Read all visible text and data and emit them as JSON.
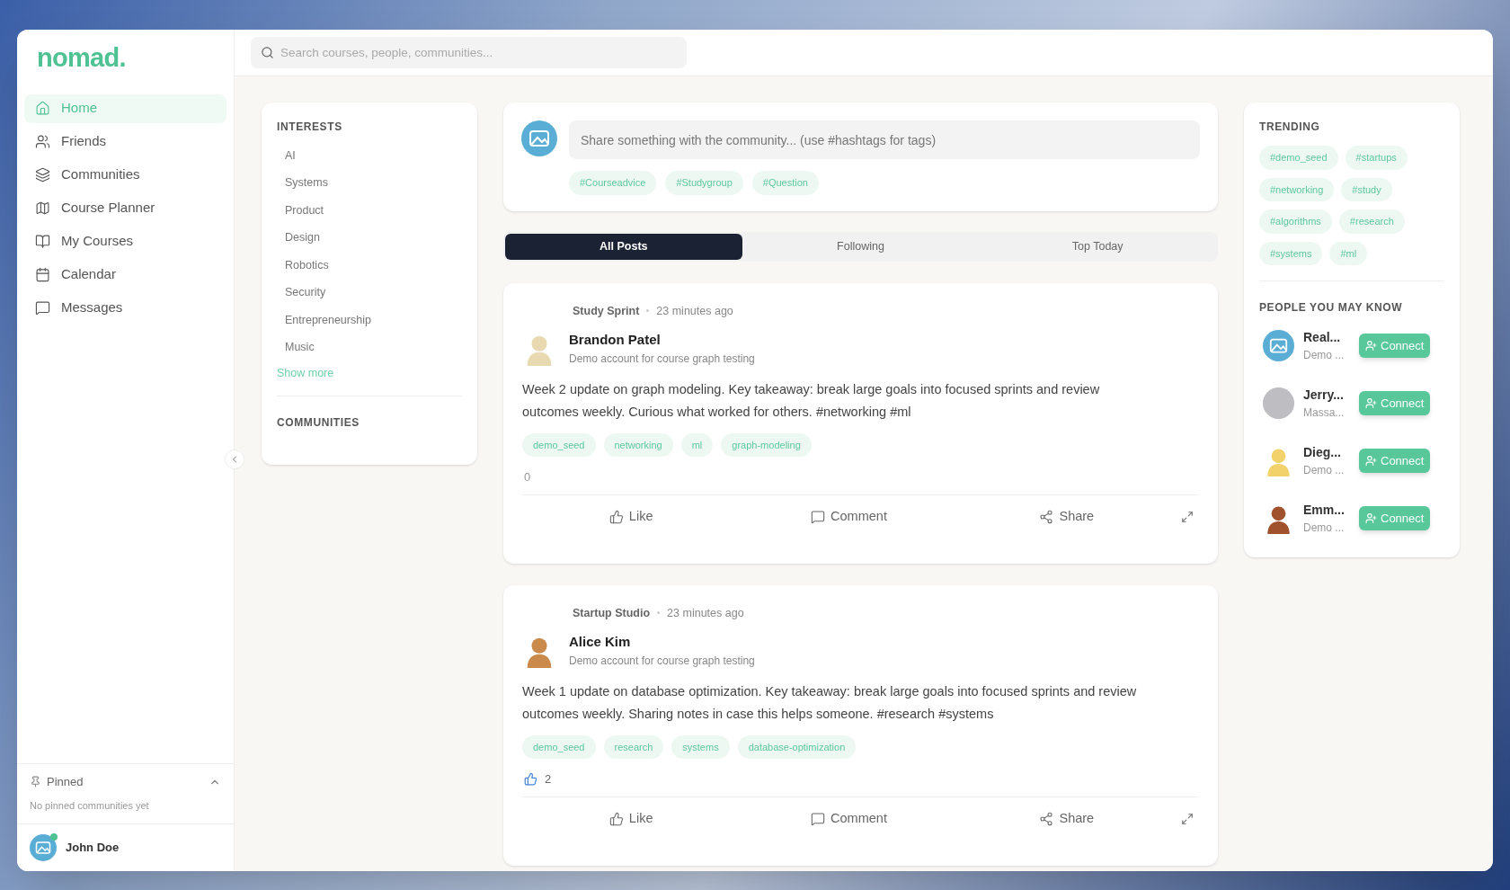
{
  "logo": "nomad.",
  "nav": [
    {
      "label": "Home",
      "selected": true
    },
    {
      "label": "Friends",
      "selected": false
    },
    {
      "label": "Communities",
      "selected": false
    },
    {
      "label": "Course Planner",
      "selected": false
    },
    {
      "label": "My Courses",
      "selected": false
    },
    {
      "label": "Calendar",
      "selected": false
    },
    {
      "label": "Messages",
      "selected": false
    }
  ],
  "pinned": {
    "title": "Pinned",
    "expanded": true,
    "empty_text": "No pinned communities yet"
  },
  "user": {
    "name": "John Doe",
    "online": true
  },
  "search": {
    "placeholder": "Search courses, people, communities..."
  },
  "interests": {
    "title": "INTERESTS",
    "items": [
      "AI",
      "Systems",
      "Product",
      "Design",
      "Robotics",
      "Security",
      "Entrepreneurship",
      "Music"
    ],
    "show_more": "Show more"
  },
  "communities": {
    "title": "COMMUNITIES"
  },
  "composer": {
    "placeholder": "Share something with the community... (use #hashtags for tags)",
    "tags": [
      "#Courseadvice",
      "#Studygroup",
      "#Question"
    ]
  },
  "tabs": [
    {
      "label": "All Posts",
      "selected": true
    },
    {
      "label": "Following",
      "selected": false
    },
    {
      "label": "Top Today",
      "selected": false
    }
  ],
  "posts": [
    {
      "community": "Study Sprint",
      "time": "23 minutes ago",
      "author": "Brandon Patel",
      "avatar": {
        "kind": "figure",
        "color": "#e8d9b0"
      },
      "subtitle": "Demo account for course graph testing",
      "body": "Week 2 update on graph modeling. Key takeaway: break large goals into focused sprints and review outcomes weekly. Curious what worked for others. #networking #ml",
      "tags": [
        "demo_seed",
        "networking",
        "ml",
        "graph-modeling"
      ],
      "liked": false,
      "likes": "0",
      "actions": [
        "Like",
        "Comment",
        "Share"
      ]
    },
    {
      "community": "Startup Studio",
      "time": "23 minutes ago",
      "author": "Alice Kim",
      "avatar": {
        "kind": "figure",
        "color": "#c98a4b"
      },
      "subtitle": "Demo account for course graph testing",
      "body": "Week 1 update on database optimization. Key takeaway: break large goals into focused sprints and review outcomes weekly. Sharing notes in case this helps someone. #research #systems",
      "tags": [
        "demo_seed",
        "research",
        "systems",
        "database-optimization"
      ],
      "liked": true,
      "likes": "2",
      "actions": [
        "Like",
        "Comment",
        "Share"
      ]
    }
  ],
  "trending": {
    "title": "TRENDING",
    "tags": [
      "#demo_seed",
      "#startups",
      "#networking",
      "#study",
      "#algorithms",
      "#research",
      "#systems",
      "#ml"
    ]
  },
  "people": {
    "title": "PEOPLE YOU MAY KNOW",
    "items": [
      {
        "name": "Real...",
        "subtitle": "Demo ...",
        "avatar": {
          "kind": "placeholder"
        },
        "button": "Connect"
      },
      {
        "name": "Jerry...",
        "subtitle": "Massa...",
        "avatar": {
          "kind": "photo"
        },
        "button": "Connect"
      },
      {
        "name": "Dieg...",
        "subtitle": "Demo ...",
        "avatar": {
          "kind": "figure",
          "color": "#f2d36b"
        },
        "button": "Connect"
      },
      {
        "name": "Emm...",
        "subtitle": "Demo ...",
        "avatar": {
          "kind": "figure",
          "color": "#a0522d"
        },
        "button": "Connect"
      }
    ]
  }
}
